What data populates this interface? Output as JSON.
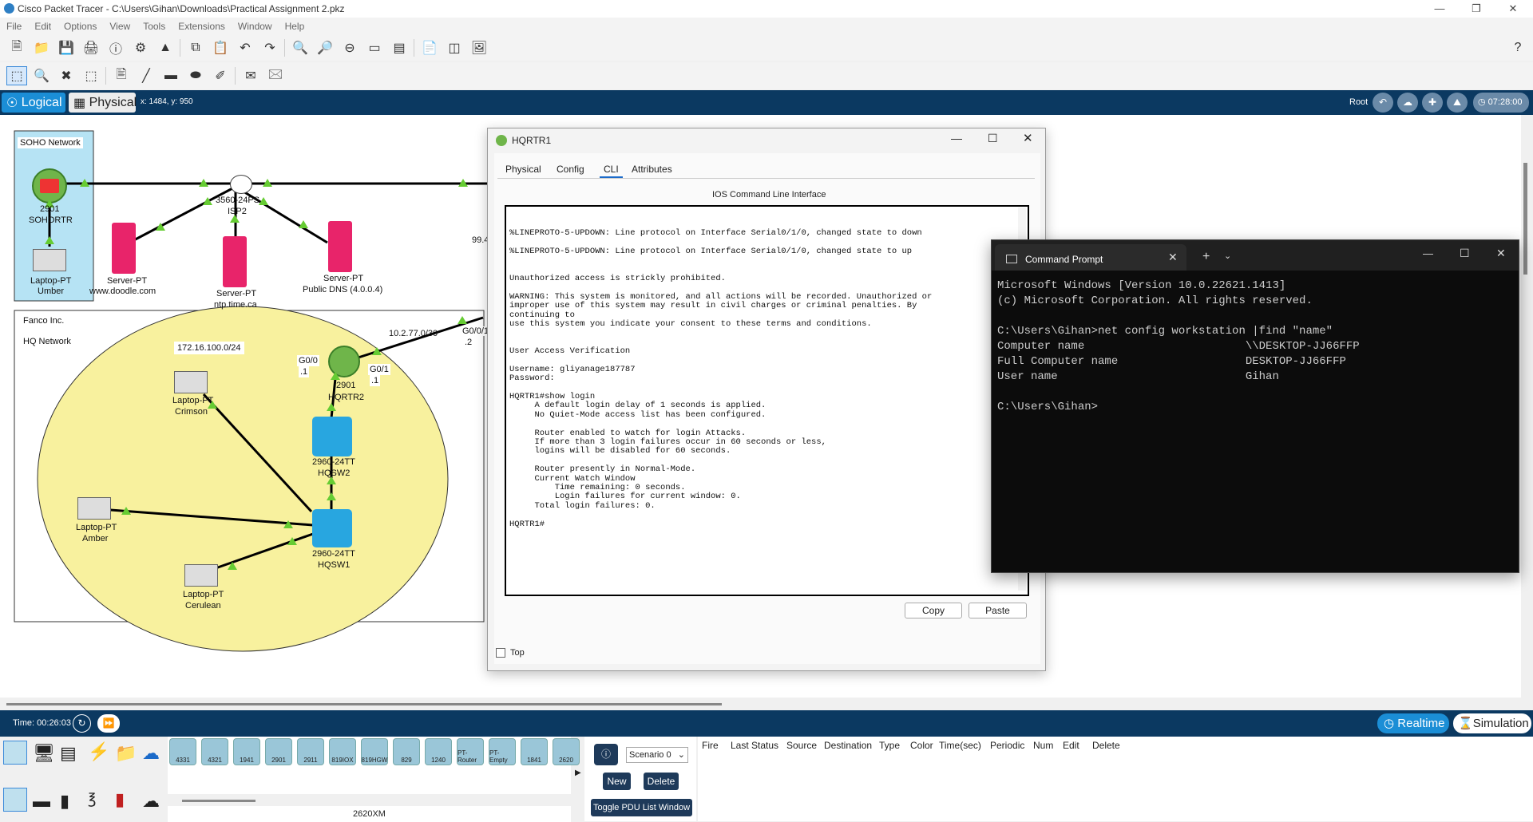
{
  "app": {
    "title": "Cisco Packet Tracer - C:\\Users\\Gihan\\Downloads\\Practical Assignment 2.pkz"
  },
  "menu": [
    "File",
    "Edit",
    "Options",
    "View",
    "Tools",
    "Extensions",
    "Window",
    "Help"
  ],
  "modebar": {
    "logical": "Logical",
    "physical": "Physical",
    "coords": "x: 1484, y: 950",
    "root": "Root",
    "time": "07:28:00"
  },
  "topology": {
    "soho_label": "SOHO Network",
    "soho_router": "2901",
    "soho_router_name": "SOHORTR",
    "laptop_umber": "Laptop-PT",
    "laptop_umber_name": "Umber",
    "isp_switch": "3560-24PS",
    "isp_name": "ISP2",
    "server1": "Server-PT",
    "server1_name": "www.doodle.com",
    "server2": "Server-PT",
    "server2_name": "ntp.time.ca",
    "server3": "Server-PT",
    "server3_name": "Public DNS (4.0.0.4)",
    "fanco": "Fanco Inc.",
    "hq": "HQ Network",
    "subnet": "172.16.100.0/24",
    "wan": "10.2.77.0/30",
    "ip994": "99.4",
    "g00": "G0/0",
    "g00_ip": ".1",
    "g01": "G0/1",
    "g01_ip": ".1",
    "g001": "G0/0/1",
    "g001_ip": ".2",
    "hqrtr": "2901",
    "hqrtr_name": "HQRTR2",
    "sw2": "2960-24TT",
    "sw2_name": "HQSW2",
    "sw1": "2960-24TT",
    "sw1_name": "HQSW1",
    "crimson": "Laptop-PT",
    "crimson_name": "Crimson",
    "amber": "Laptop-PT",
    "amber_name": "Amber",
    "cerulean": "Laptop-PT",
    "cerulean_name": "Cerulean"
  },
  "hqrtr": {
    "title": "HQRTR1",
    "tabs": [
      "Physical",
      "Config",
      "CLI",
      "Attributes"
    ],
    "active_tab": "CLI",
    "heading": "IOS Command Line Interface",
    "lines": [
      "%LINEPROTO-5-UPDOWN: Line protocol on Interface Serial0/1/0, changed state to down",
      "",
      "%LINEPROTO-5-UPDOWN: Line protocol on Interface Serial0/1/0, changed state to up",
      "",
      "",
      "Unauthorized access is strickly prohibited.",
      "",
      "WARNING: This system is monitored, and all actions will be recorded. Unauthorized or",
      "improper use of this system may result in civil charges or criminal penalties. By",
      "continuing to",
      "use this system you indicate your consent to these terms and conditions.",
      "",
      "",
      "User Access Verification",
      "",
      "Username: gliyanage187787",
      "Password:",
      "",
      "HQRTR1#show login",
      "     A default login delay of 1 seconds is applied.",
      "     No Quiet-Mode access list has been configured.",
      "",
      "     Router enabled to watch for login Attacks.",
      "     If more than 3 login failures occur in 60 seconds or less,",
      "     logins will be disabled for 60 seconds.",
      "",
      "     Router presently in Normal-Mode.",
      "     Current Watch Window",
      "         Time remaining: 0 seconds.",
      "         Login failures for current window: 0.",
      "     Total login failures: 0.",
      "",
      "HQRTR1#"
    ],
    "copy": "Copy",
    "paste": "Paste",
    "top": "Top"
  },
  "cmd": {
    "title": "Command Prompt",
    "lines": [
      "Microsoft Windows [Version 10.0.22621.1413]",
      "(c) Microsoft Corporation. All rights reserved.",
      "",
      "C:\\Users\\Gihan>net config workstation |find \"name\"",
      "Computer name                        \\\\DESKTOP-JJ66FFP",
      "Full Computer name                   DESKTOP-JJ66FFP",
      "User name                            Gihan",
      "",
      "C:\\Users\\Gihan>"
    ]
  },
  "bottom": {
    "time": "Time: 00:26:03",
    "realtime": "Realtime",
    "simulation": "Simulation",
    "devices": [
      "4331",
      "4321",
      "1941",
      "2901",
      "2911",
      "819IOX",
      "819HGW",
      "829",
      "1240",
      "PT-Router",
      "PT-Empty",
      "1841",
      "2620"
    ],
    "selected_device": "2620XM",
    "scenario": "Scenario 0",
    "new": "New",
    "delete": "Delete",
    "toggle": "Toggle PDU List Window",
    "pdu_cols": [
      "Fire",
      "Last Status",
      "Source",
      "Destination",
      "Type",
      "Color",
      "Time(sec)",
      "Periodic",
      "Num",
      "Edit",
      "Delete"
    ]
  }
}
